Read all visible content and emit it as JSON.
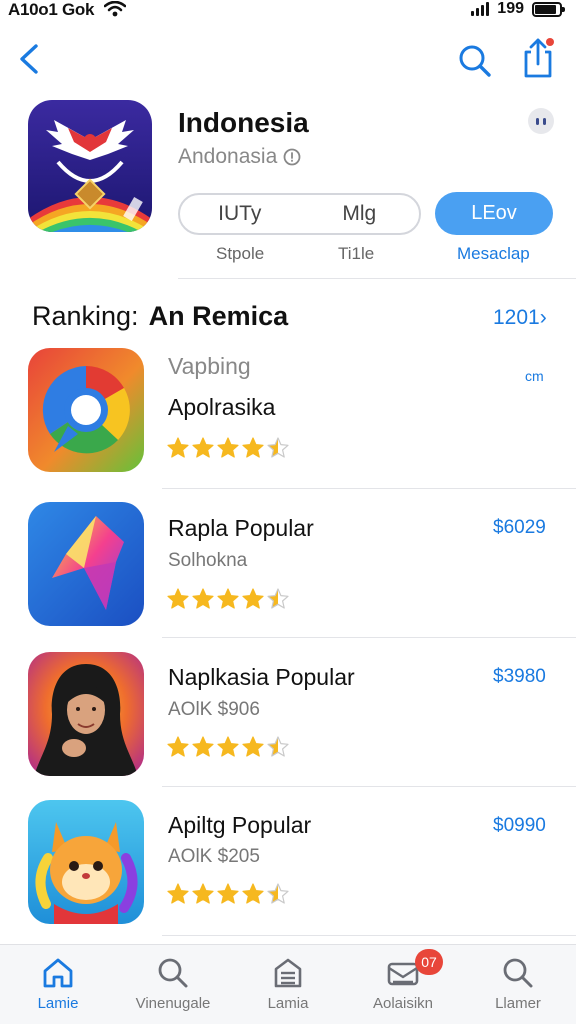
{
  "status_bar": {
    "time": "A10o1 Gok",
    "battery_text": "199"
  },
  "hero": {
    "title": "Indonesia",
    "subtitle": "Andonasia",
    "pill_left": "IUTy",
    "pill_right": "Mlg",
    "action_label": "LEov",
    "caption_left": "Stpole",
    "caption_mid": "Ti1le",
    "caption_right": "Mesaclap"
  },
  "ranking": {
    "label": "Ranking:",
    "title": "An Remica",
    "link": "1201",
    "small": "cm"
  },
  "apps": [
    {
      "name": "Vapbing",
      "sub": "Apolrasika",
      "rating": 4.5,
      "price": ""
    },
    {
      "name": "Rapla Popular",
      "sub": "Solhokna",
      "rating": 4.5,
      "price": "$6029"
    },
    {
      "name": "Naplkasia Popular",
      "sub": "AOlK $906",
      "rating": 4.5,
      "price": "$3980"
    },
    {
      "name": "Apiltg Popular",
      "sub": "AOlK $205",
      "rating": 4.5,
      "price": "$0990"
    }
  ],
  "tabs": [
    {
      "label": "Lamie",
      "icon": "home-icon",
      "active": true
    },
    {
      "label": "Vinenugale",
      "icon": "search-icon",
      "active": false
    },
    {
      "label": "Lamia",
      "icon": "list-icon",
      "active": false
    },
    {
      "label": "Aolaisikn",
      "icon": "inbox-icon",
      "active": false,
      "badge": "07"
    },
    {
      "label": "Llamer",
      "icon": "search-icon",
      "active": false
    }
  ],
  "colors": {
    "accent": "#1a7ae0",
    "button": "#4aa0f2",
    "star": "#f6b81f",
    "badge": "#e8463a"
  }
}
